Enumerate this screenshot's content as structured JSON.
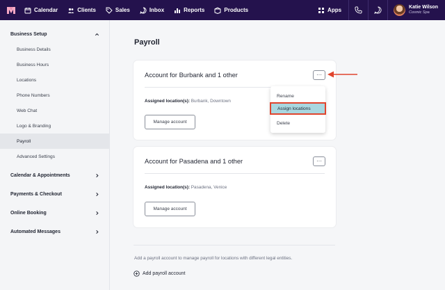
{
  "nav": {
    "items": [
      {
        "label": "Calendar",
        "icon": "calendar-icon"
      },
      {
        "label": "Clients",
        "icon": "clients-icon"
      },
      {
        "label": "Sales",
        "icon": "sales-icon"
      },
      {
        "label": "Inbox",
        "icon": "inbox-icon"
      },
      {
        "label": "Reports",
        "icon": "reports-icon"
      },
      {
        "label": "Products",
        "icon": "products-icon"
      }
    ],
    "apps_label": "Apps",
    "user_name": "Katie Wilson",
    "business": "Cosmic Spa"
  },
  "sidebar": {
    "business_setup": "Business Setup",
    "items": [
      "Business Details",
      "Business Hours",
      "Locations",
      "Phone Numbers",
      "Web Chat",
      "Logo & Branding",
      "Payroll",
      "Advanced Settings"
    ],
    "active": "Payroll",
    "sections": [
      "Calendar & Appointments",
      "Payments & Checkout",
      "Online Booking",
      "Automated Messages"
    ]
  },
  "main": {
    "title": "Payroll",
    "cards": [
      {
        "title": "Account for Burbank and 1 other",
        "assigned_label": "Assigned location(s):",
        "locations": "Burbank, Downtown",
        "button": "Manage account"
      },
      {
        "title": "Account for Pasadena and 1 other",
        "assigned_label": "Assigned location(s):",
        "locations": "Pasadena, Venice",
        "button": "Manage account"
      }
    ],
    "menu": {
      "items": [
        "Rename",
        "Assign locations",
        "Delete"
      ],
      "highlighted": "Assign locations"
    },
    "help_text": "Add a payroll account to manage payroll for locations with different legal entities.",
    "add_label": "Add payroll account"
  },
  "colors": {
    "nav_bg": "#24124d",
    "highlight": "#a9d7e0",
    "annotation": "#e0442d"
  }
}
